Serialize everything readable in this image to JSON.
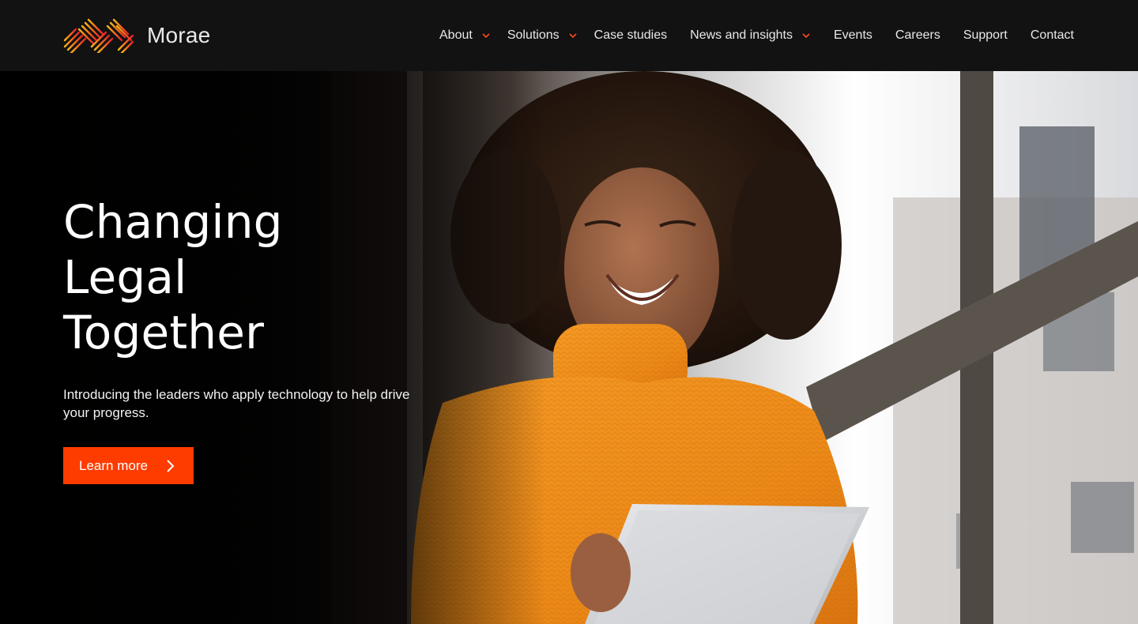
{
  "brand": {
    "name": "Morae",
    "logo_icon": "morae-logo-icon"
  },
  "nav": {
    "items": [
      {
        "label": "About",
        "has_dropdown": true
      },
      {
        "label": "Solutions",
        "has_dropdown": true
      },
      {
        "label": "Case studies",
        "has_dropdown": false
      },
      {
        "label": "News and insights",
        "has_dropdown": true
      },
      {
        "label": "Events",
        "has_dropdown": false
      },
      {
        "label": "Careers",
        "has_dropdown": false
      },
      {
        "label": "Support",
        "has_dropdown": false
      },
      {
        "label": "Contact",
        "has_dropdown": false
      }
    ],
    "dropdown_icon": "chevron-down-icon"
  },
  "hero": {
    "title_lines": [
      "Changing",
      "Legal",
      "Together"
    ],
    "subtitle": "Introducing the leaders who apply technology to help drive your progress.",
    "cta_label": "Learn more",
    "cta_icon": "chevron-right-icon"
  },
  "colors": {
    "accent": "#ff3c00",
    "header_bg": "#121212",
    "chevron": "#ff4a1a"
  }
}
